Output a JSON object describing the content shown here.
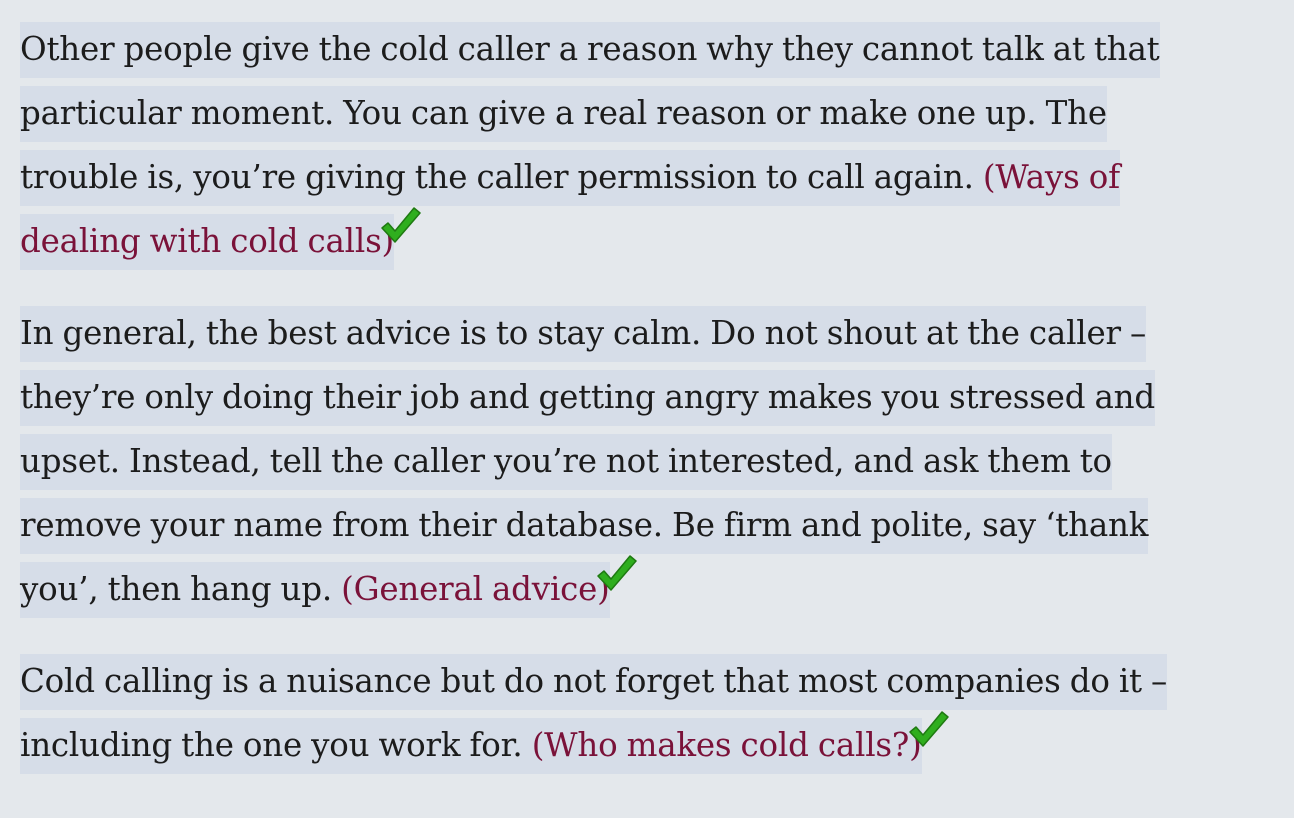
{
  "paragraphs": [
    {
      "text": "Other people give the cold caller a reason why they cannot talk at that particular moment. You can give a real reason or make one up. The trouble is, you’re giving the caller permission to call again. ",
      "answer": "(Ways of dealing with cold calls)",
      "icon": "checkmark-icon"
    },
    {
      "text": "In general, the best advice is to stay calm. Do not shout at the caller – they’re only doing their job and getting angry makes you stressed and upset. Instead, tell the caller you’re not interested, and ask them to remove your name from their database. Be firm and polite, say ‘thank you’, then hang up. ",
      "answer": "(General advice)",
      "icon": "checkmark-icon"
    },
    {
      "text": "Cold calling is a nuisance but do not forget that most companies do it – including the one you work for. ",
      "answer": "(Who makes cold calls?)",
      "icon": "checkmark-icon"
    }
  ],
  "colors": {
    "background": "#e4e8ec",
    "highlight": "#d6dde8",
    "answer_text": "#7a1239",
    "checkmark": "#2fae1e"
  }
}
